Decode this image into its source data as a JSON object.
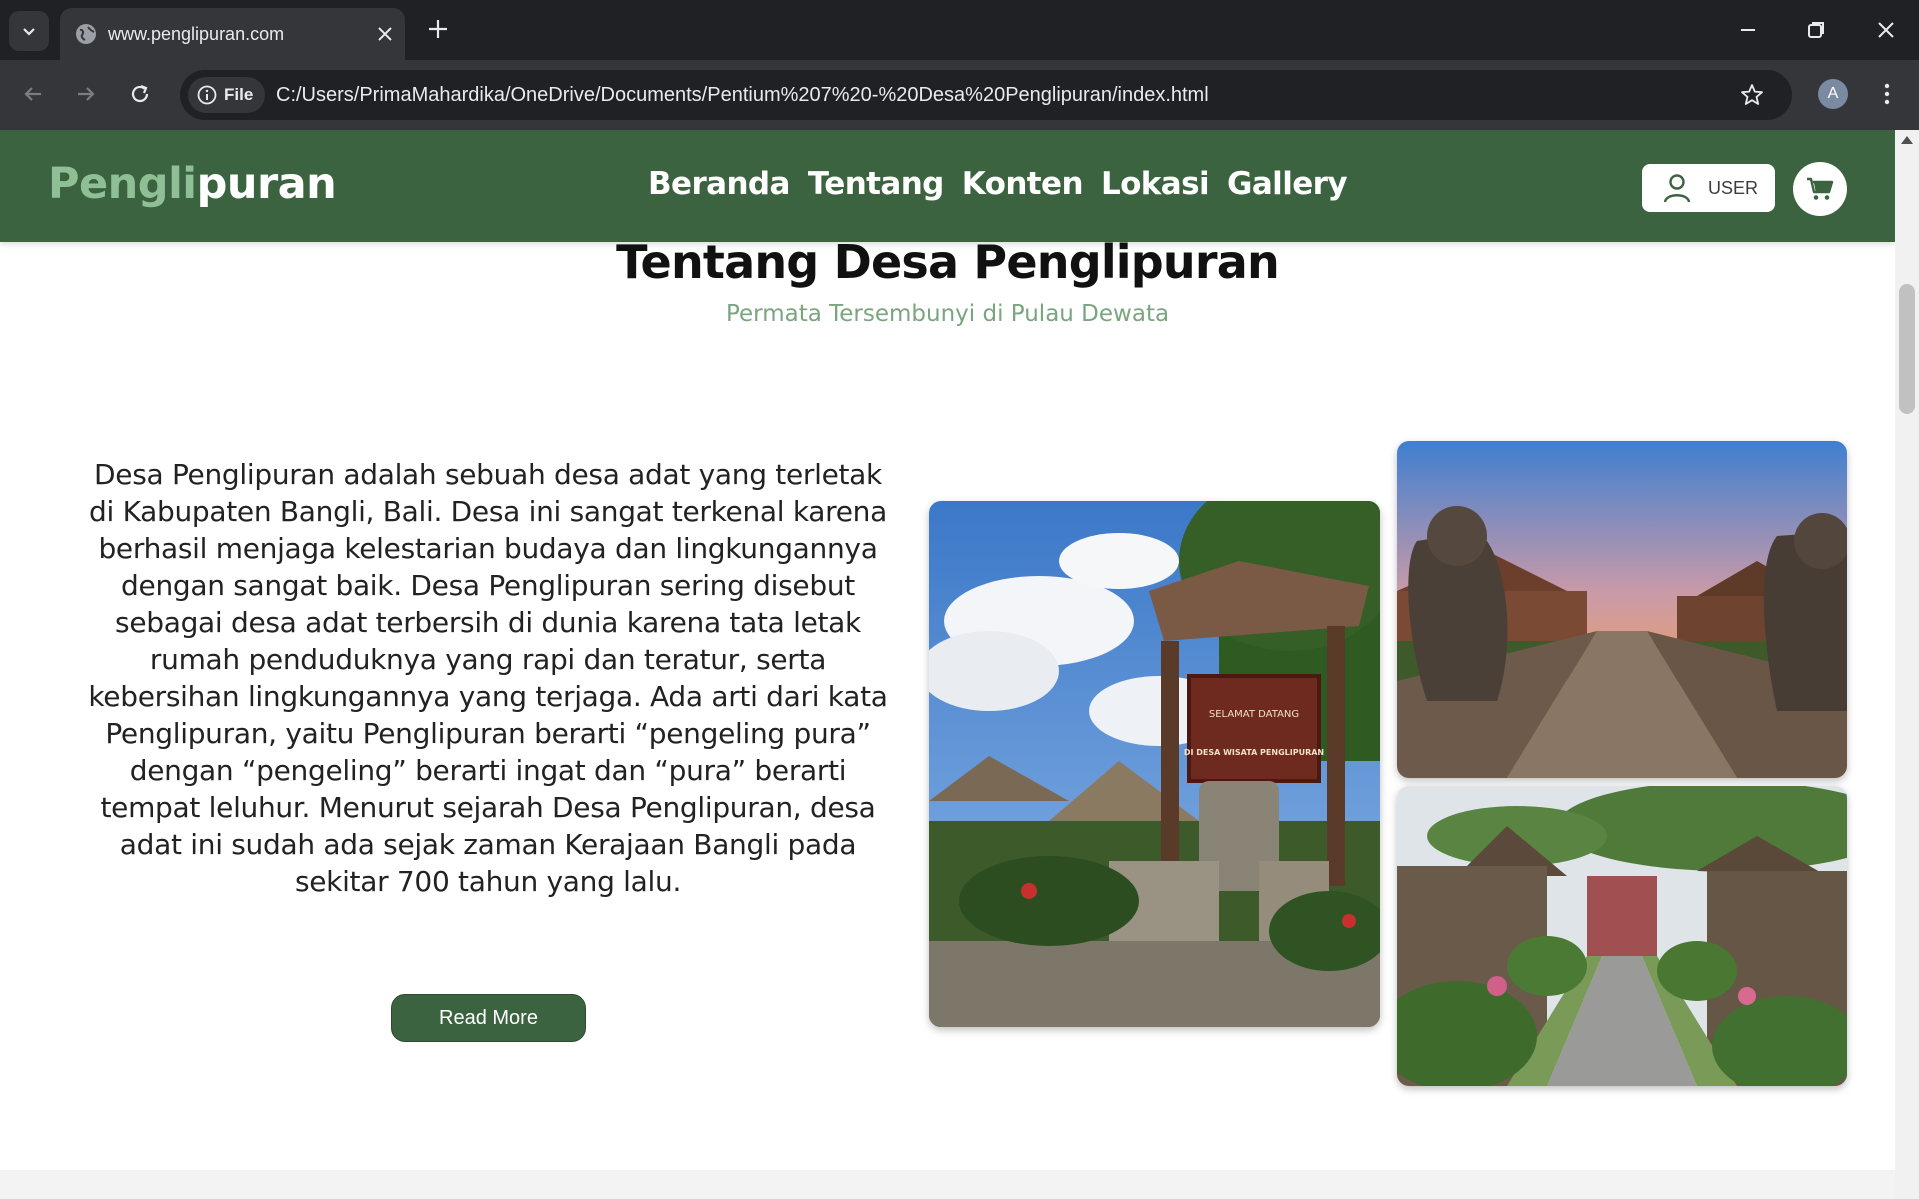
{
  "browser": {
    "tab_title": "www.penglipuran.com",
    "chip_label": "File",
    "url": "C:/Users/PrimaMahardika/OneDrive/Documents/Pentium%207%20-%20Desa%20Penglipuran/index.html",
    "profile_initial": "A"
  },
  "site": {
    "logo_part1": "Pengli",
    "logo_part2": "puran",
    "nav": [
      "Beranda",
      "Tentang",
      "Konten",
      "Lokasi",
      "Gallery"
    ],
    "user_label": "USER"
  },
  "about": {
    "title": "Tentang Desa Penglipuran",
    "subtitle": "Permata Tersembunyi di Pulau Dewata",
    "paragraph": "Desa Penglipuran adalah sebuah desa adat yang terletak di Kabupaten Bangli, Bali. Desa ini sangat terkenal karena berhasil menjaga kelestarian budaya dan lingkungannya dengan sangat baik. Desa Penglipuran sering disebut sebagai desa adat terbersih di dunia karena tata letak rumah penduduknya yang rapi dan teratur, serta kebersihan lingkungannya yang terjaga. Ada arti dari kata Penglipuran, yaitu Penglipuran berarti “pengeling pura” dengan “pengeling” berarti ingat dan “pura” berarti tempat leluhur. Menurut sejarah Desa Penglipuran, desa adat ini sudah ada sejak zaman Kerajaan Bangli pada sekitar 700 tahun yang lalu.",
    "read_more": "Read More",
    "sign_line1": "SELAMAT DATANG",
    "sign_line2": "DI DESA WISATA PENGLIPURAN"
  },
  "colors": {
    "header": "#3c6340",
    "logo_accent": "#8fbf95",
    "subtitle": "#7aa57f"
  }
}
